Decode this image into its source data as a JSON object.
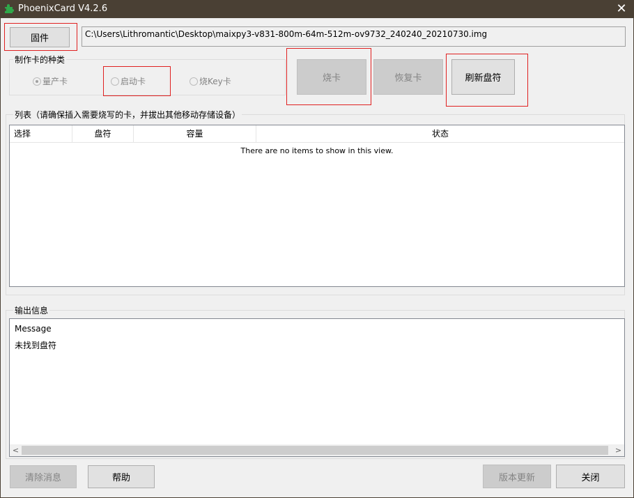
{
  "window": {
    "title": "PhoenixCard V4.2.6",
    "close_glyph": "✕"
  },
  "firmware": {
    "button_label": "固件",
    "path": "C:\\Users\\Lithromantic\\Desktop\\maixpy3-v831-800m-64m-512m-ov9732_240240_20210730.img"
  },
  "card_type": {
    "group_title": "制作卡的种类",
    "options": [
      {
        "label": "量产卡",
        "checked": true
      },
      {
        "label": "启动卡",
        "checked": false
      },
      {
        "label": "烧Key卡",
        "checked": false
      }
    ]
  },
  "actions": {
    "burn": "烧卡",
    "restore": "恢复卡",
    "refresh": "刷新盘符"
  },
  "list": {
    "group_title": "列表（请确保插入需要烧写的卡，并拔出其他移动存储设备）",
    "columns": [
      "选择",
      "盘符",
      "容量",
      "状态"
    ],
    "empty_text": "There are no items to show in this view."
  },
  "output": {
    "group_title": "输出信息",
    "lines": [
      "Message",
      "未找到盘符"
    ]
  },
  "footer": {
    "clear": "清除消息",
    "help": "帮助",
    "update": "版本更新",
    "close": "关闭"
  },
  "colors": {
    "titlebar": "#4a4034",
    "highlight": "#e02020",
    "disabled_button": "#cccccc"
  },
  "icons": {
    "app": "phoenix-puzzle-icon",
    "close": "close-icon",
    "scroll_left": "chevron-left-icon",
    "scroll_right": "chevron-right-icon"
  }
}
